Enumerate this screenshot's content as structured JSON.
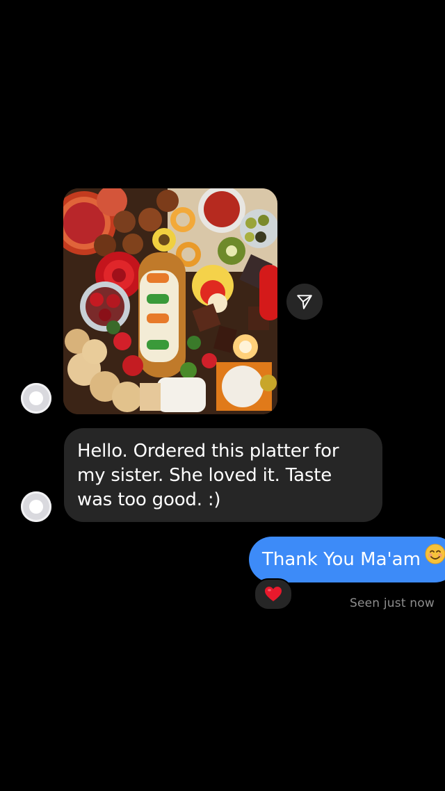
{
  "conversation": {
    "shared_photo": {
      "icon": "food-platter-photo"
    },
    "share_button": {
      "icon": "send-icon"
    },
    "incoming_message": {
      "text": "Hello. Ordered this platter for my sister. She loved it. Taste was too good. :)"
    },
    "outgoing_message": {
      "text": "Thank You Ma'am",
      "emoji": "smiling-face-icon"
    },
    "reaction": {
      "icon": "heart-icon"
    },
    "seen_status": "Seen just now"
  },
  "colors": {
    "background": "#000000",
    "incoming_bubble": "#262626",
    "outgoing_bubble": "#3d8bf8",
    "heart": "#e8192c",
    "seen_text": "#8e8e8e"
  }
}
